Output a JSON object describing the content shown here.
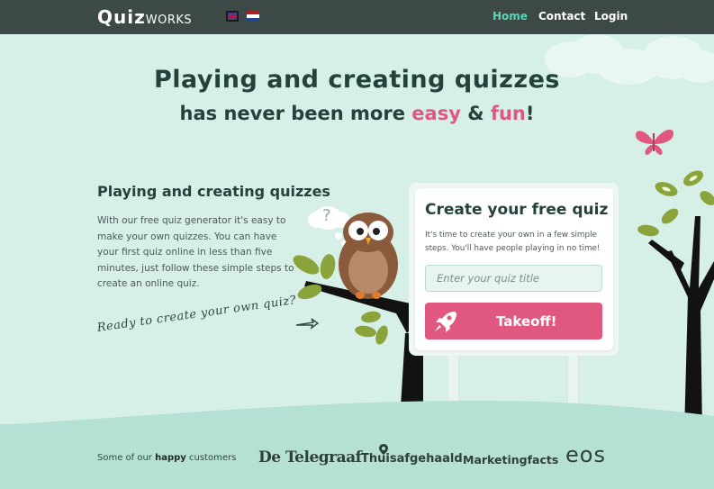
{
  "nav": {
    "logo_quiz": "Quiz",
    "logo_works": "WORKS",
    "home": "Home",
    "contact": "Contact",
    "login": "Login",
    "languages": [
      "English",
      "Nederlands"
    ]
  },
  "hero": {
    "title": "Playing and creating quizzes",
    "sub_prefix": "has never been more ",
    "sub_easy": "easy",
    "sub_amp": " & ",
    "sub_fun": "fun",
    "sub_suffix": "!"
  },
  "intro": {
    "title": "Playing and creating quizzes",
    "body": "With our free quiz generator it's easy to make your own quizzes. You can have your first quiz online in less than five minutes, just follow these simple steps to create an online quiz.",
    "ready": "Ready to create your own quiz?"
  },
  "owl": {
    "thought_glyph": "?"
  },
  "card": {
    "title": "Create your free quiz",
    "text": "It's time to create your own in a few simple steps. You'll have people playing in no time!",
    "input_placeholder": "Enter your quiz title",
    "button_label": "Takeoff!"
  },
  "footer": {
    "prefix": "Some of our ",
    "happy": "happy",
    "suffix": " customers",
    "brands": [
      "De Telegraaf",
      "Thuisafgehaald",
      "Marketingfacts",
      "eos"
    ]
  },
  "colors": {
    "accent": "#e0577f",
    "nav_bg": "#3c4947",
    "nav_active": "#5fd3b6",
    "page_bg": "#d6efe7",
    "footer_bg": "#b5e0d4"
  }
}
